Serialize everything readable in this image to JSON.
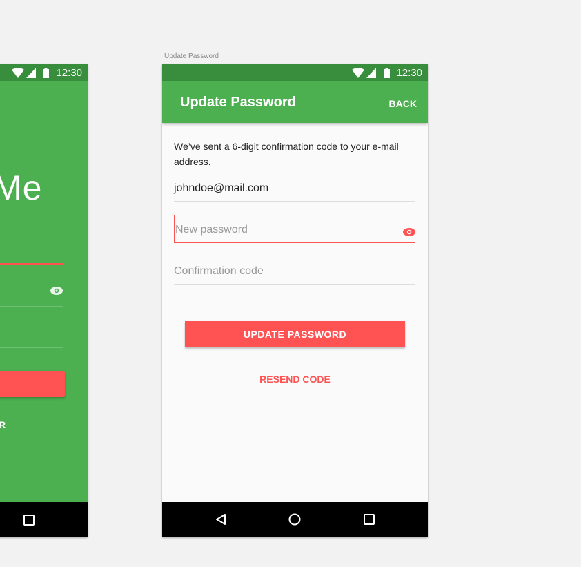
{
  "artboard_label": "Update Password",
  "colors": {
    "primary": "#4caf50",
    "primary_dark": "#388e3c",
    "accent": "#ff5252",
    "background": "#fafafa"
  },
  "status_bar": {
    "time": "12:30",
    "icons": [
      "wifi-icon",
      "signal-icon",
      "battery-icon"
    ]
  },
  "left_screen": {
    "title_fragment": "Me",
    "button_fragment": "R"
  },
  "app_bar": {
    "title": "Update Password",
    "back_label": "BACK"
  },
  "form": {
    "message": "We’ve sent a 6-digit confirmation code to your e-mail address.",
    "email_value": "johndoe@mail.com",
    "password_placeholder": "New password",
    "code_placeholder": "Confirmation code",
    "submit_label": "UPDATE PASSWORD",
    "resend_label": "RESEND CODE"
  },
  "nav_bar": {
    "icons": [
      "back-icon",
      "home-icon",
      "recents-icon"
    ]
  }
}
